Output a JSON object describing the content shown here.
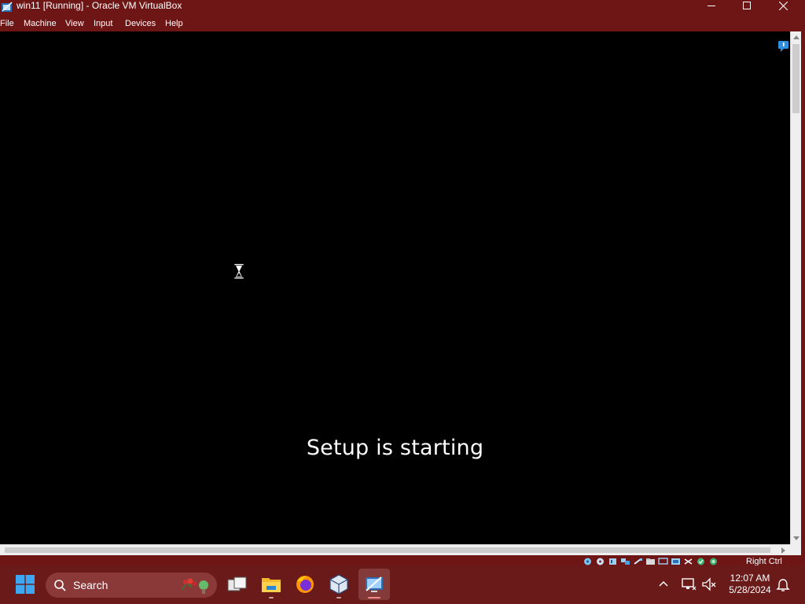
{
  "window": {
    "title": "win11 [Running] - Oracle VM VirtualBox",
    "controls": [
      "minimize-icon",
      "maximize-icon",
      "close-icon"
    ]
  },
  "menu": {
    "file": "File",
    "machine": "Machine",
    "view": "View",
    "input": "Input",
    "devices": "Devices",
    "help": "Help"
  },
  "vm": {
    "message": "Setup is starting",
    "cursor": "hourglass-icon",
    "background": "#000000"
  },
  "statusbar": {
    "icons": [
      "hard-disk-icon",
      "optical-disk-icon",
      "audio-icon",
      "network-icon",
      "usb-icon",
      "shared-folder-icon",
      "display-icon",
      "recording-icon",
      "cpu-icon",
      "keyboard-icon",
      "mouse-integration-icon",
      "capture-icon"
    ],
    "host_key": "Right Ctrl"
  },
  "taskbar": {
    "search_label": "Search",
    "apps": [
      "start-icon",
      "task-view-icon",
      "file-explorer-icon",
      "firefox-icon",
      "virtualbox-manager-icon",
      "virtualbox-vm-icon"
    ],
    "clock": {
      "time": "12:07 AM",
      "date": "5/28/2024"
    }
  },
  "colors": {
    "chrome": "#6e1515",
    "taskbar": "#6b1a1a",
    "search_box": "#8a3838"
  }
}
